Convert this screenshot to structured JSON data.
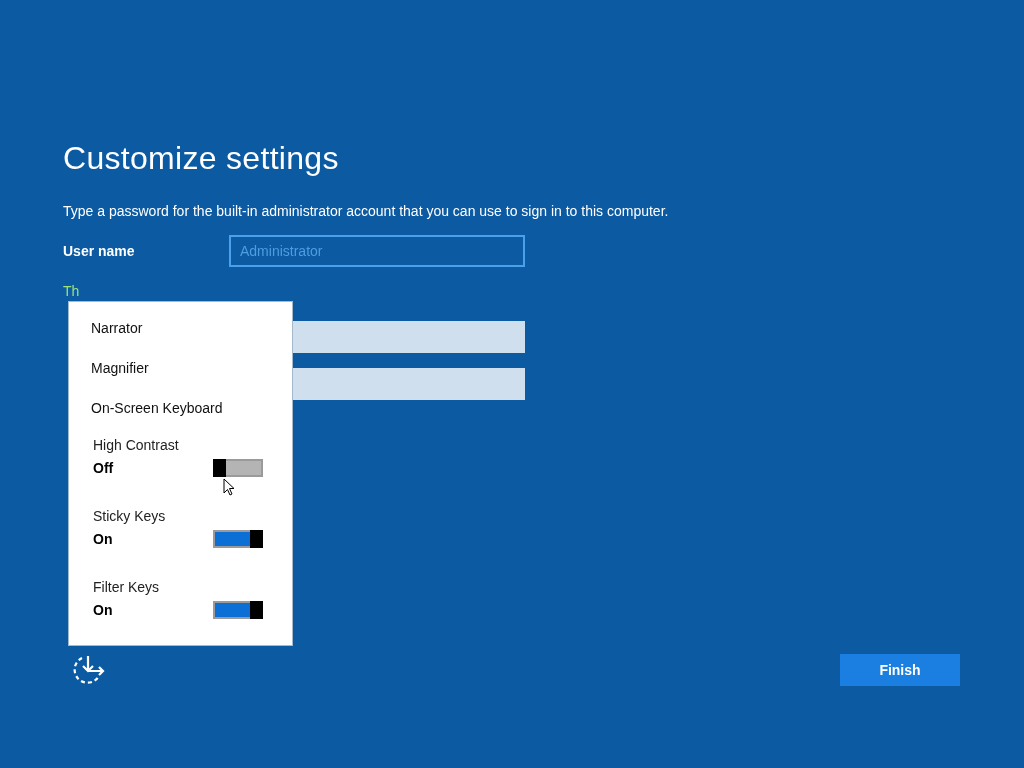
{
  "title": "Customize settings",
  "description": "Type a password for the built-in administrator account that you can use to sign in to this computer.",
  "fields": [
    {
      "label": "User name",
      "placeholder": "Administrator",
      "kind": "outline"
    },
    {
      "kind": "hint",
      "label": "Th"
    },
    {
      "kind": "filled"
    },
    {
      "kind": "filled"
    }
  ],
  "accessibility_menu": {
    "items": [
      {
        "kind": "link",
        "label": "Narrator"
      },
      {
        "kind": "link",
        "label": "Magnifier"
      },
      {
        "kind": "link",
        "label": "On-Screen Keyboard"
      },
      {
        "kind": "toggle",
        "label": "High Contrast",
        "state": "Off",
        "on": false
      },
      {
        "kind": "toggle",
        "label": "Sticky Keys",
        "state": "On",
        "on": true
      },
      {
        "kind": "toggle",
        "label": "Filter Keys",
        "state": "On",
        "on": true
      }
    ]
  },
  "finish_button": "Finish"
}
